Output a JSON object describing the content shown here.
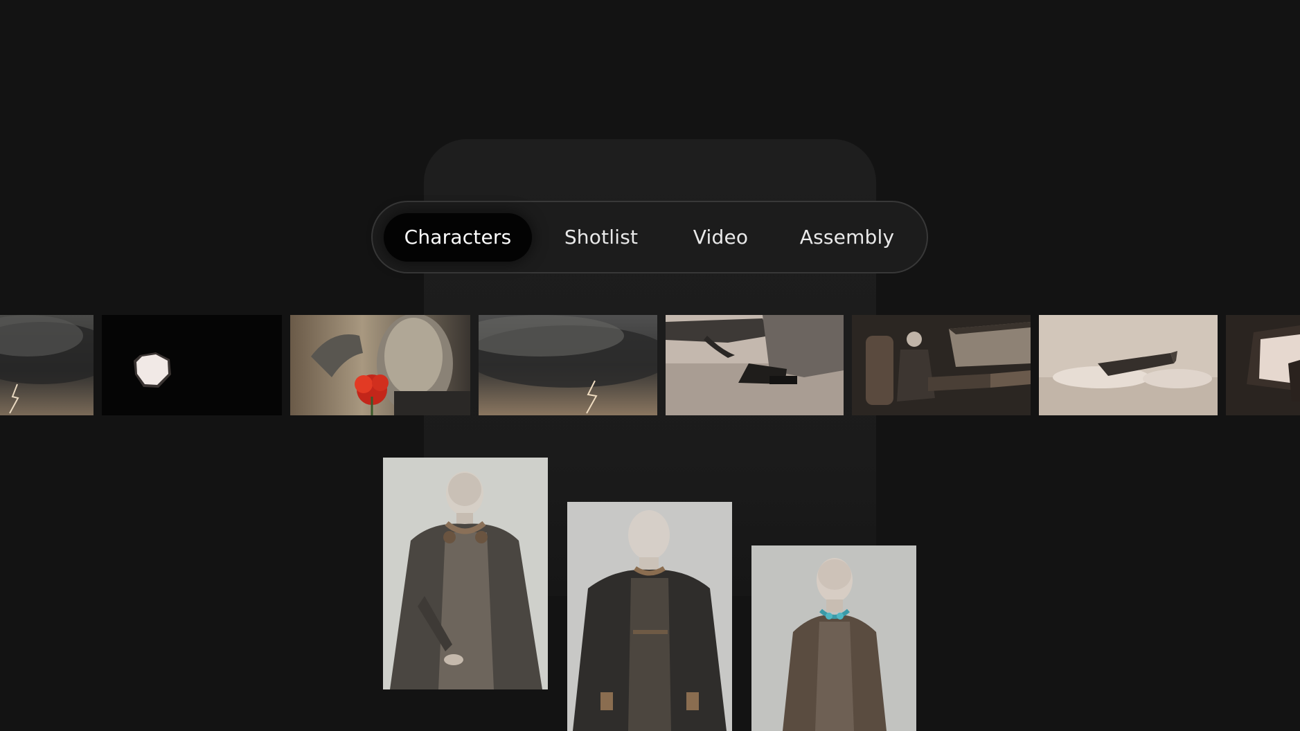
{
  "tabs": {
    "items": [
      {
        "label": "Characters",
        "active": true
      },
      {
        "label": "Shotlist",
        "active": false
      },
      {
        "label": "Video",
        "active": false
      },
      {
        "label": "Assembly",
        "active": false
      }
    ]
  },
  "filmstrip": {
    "frames": [
      "storm-cloud-lightning",
      "white-hexagonal-object-on-black",
      "figure-holding-red-flower",
      "storm-cloud-lightning",
      "foot-stepping-out-of-ship",
      "figure-seated-in-ship-cabin",
      "ship-landing-dust",
      "ship-window-interior"
    ]
  },
  "characters": [
    {
      "portrait": "bald-woman-in-robe-with-headphones"
    },
    {
      "portrait": "bald-man-in-dark-robe"
    },
    {
      "portrait": "bald-girl-in-brown-robe"
    }
  ],
  "colors": {
    "background": "#131313",
    "panel": "#1c1c1c",
    "active_tab": "#030303",
    "tab_text": "#e9e9e9",
    "accent_red": "#d62a1a"
  }
}
